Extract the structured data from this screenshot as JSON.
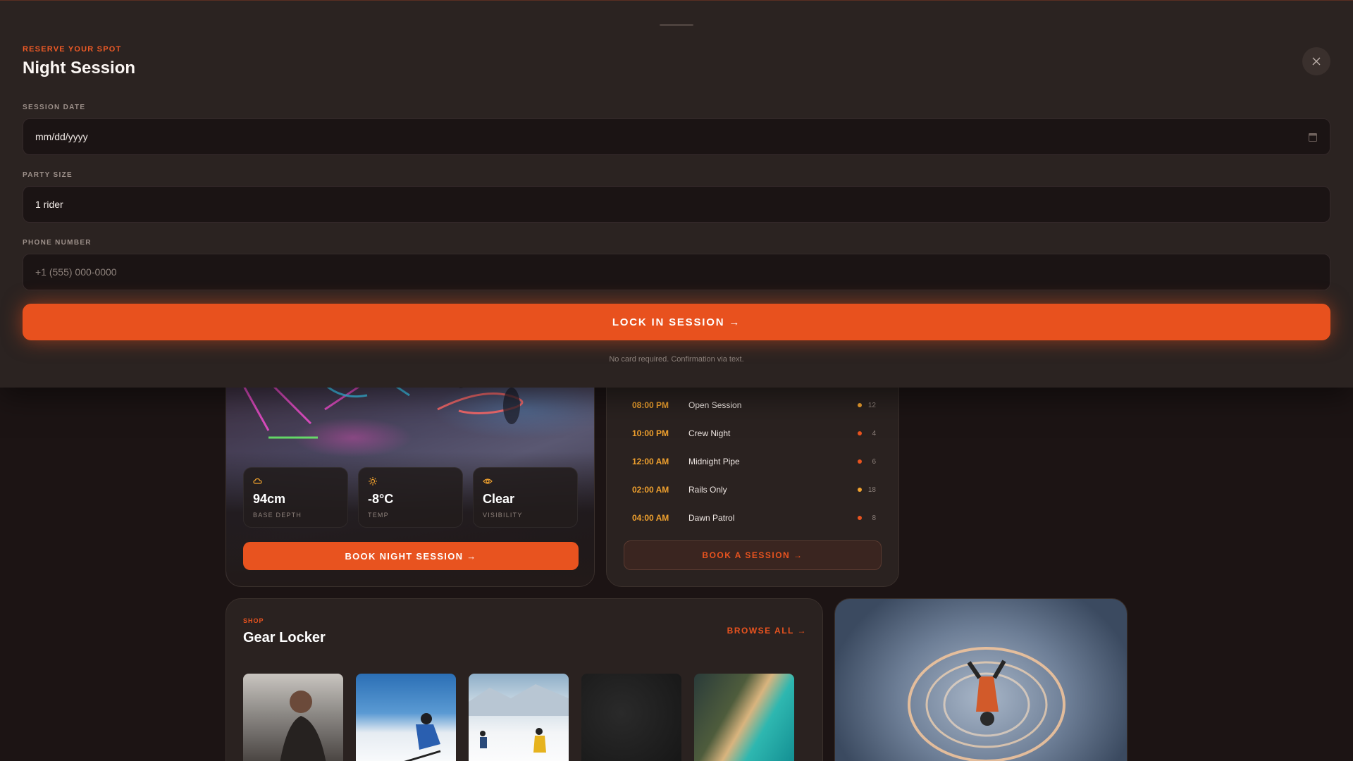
{
  "modal": {
    "eyebrow": "RESERVE YOUR SPOT",
    "title": "Night Session",
    "close_icon": "close-icon",
    "fields": {
      "date": {
        "label": "SESSION DATE",
        "placeholder": "mm/dd/yyyy",
        "icon": "calendar-icon"
      },
      "party": {
        "label": "PARTY SIZE",
        "value": "1 rider"
      },
      "phone": {
        "label": "PHONE NUMBER",
        "placeholder": "+1 (555) 000-0000"
      }
    },
    "cta_label": "LOCK IN SESSION →",
    "note": "No card required. Confirmation via text."
  },
  "conditions": {
    "stats": [
      {
        "icon": "cloud-icon",
        "value": "94cm",
        "label": "BASE DEPTH"
      },
      {
        "icon": "sun-icon",
        "value": "-8°C",
        "label": "TEMP"
      },
      {
        "icon": "eye-icon",
        "value": "Clear",
        "label": "VISIBILITY"
      }
    ],
    "button_label": "BOOK NIGHT SESSION →"
  },
  "schedule": {
    "rows": [
      {
        "time": "08:00 PM",
        "name": "Open Session",
        "count": "12",
        "dot_color": "#f0a12e"
      },
      {
        "time": "10:00 PM",
        "name": "Crew Night",
        "count": "4",
        "dot_color": "#e8531f"
      },
      {
        "time": "12:00 AM",
        "name": "Midnight Pipe",
        "count": "6",
        "dot_color": "#e8531f"
      },
      {
        "time": "02:00 AM",
        "name": "Rails Only",
        "count": "18",
        "dot_color": "#f0a12e"
      },
      {
        "time": "04:00 AM",
        "name": "Dawn Patrol",
        "count": "8",
        "dot_color": "#e8531f"
      }
    ],
    "button_label": "BOOK A SESSION →"
  },
  "shop": {
    "eyebrow": "SHOP",
    "title": "Gear Locker",
    "browse_label": "BROWSE ALL →"
  },
  "colors": {
    "accent": "#e8531f",
    "time_accent": "#f0a12e",
    "background": "#1c1414",
    "sheet": "#2b2321"
  }
}
